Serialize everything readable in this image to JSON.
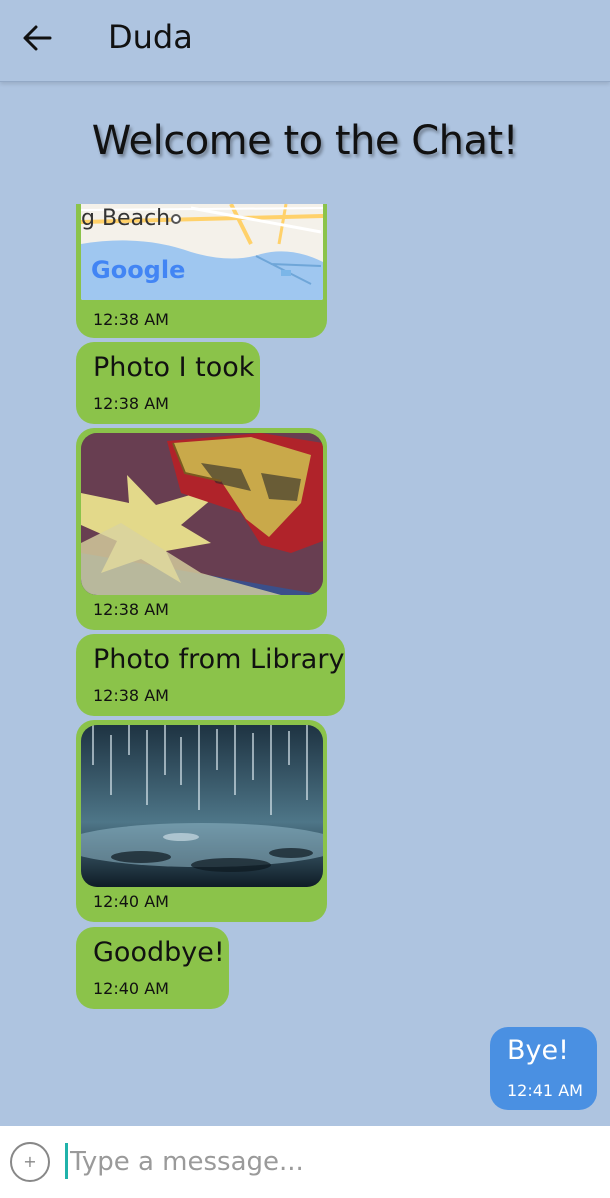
{
  "header": {
    "title": "Duda",
    "back_icon": "arrow-left-icon"
  },
  "welcome": "Welcome to the Chat!",
  "map_preview": {
    "place_text": "g Beach",
    "logo_text": "Google"
  },
  "messages": [
    {
      "type": "map",
      "time": "12:38 AM"
    },
    {
      "type": "text",
      "text": "Photo I took",
      "time": "12:38 AM"
    },
    {
      "type": "image",
      "image": "iron-man-mask-photo",
      "time": "12:38 AM"
    },
    {
      "type": "text",
      "text": "Photo from Library",
      "time": "12:38 AM"
    },
    {
      "type": "image",
      "image": "rain-drops-photo",
      "time": "12:40 AM"
    },
    {
      "type": "text",
      "text": "Goodbye!",
      "time": "12:40 AM"
    },
    {
      "type": "text",
      "text": "Bye!",
      "time": "12:41 AM",
      "outgoing": true
    }
  ],
  "composer": {
    "placeholder": "Type a message...",
    "add_icon": "plus-circle-icon"
  },
  "colors": {
    "background": "#aec4e0",
    "incoming_bubble": "#8bc34a",
    "outgoing_bubble": "#4a90e2",
    "cursor": "#20b2aa"
  }
}
